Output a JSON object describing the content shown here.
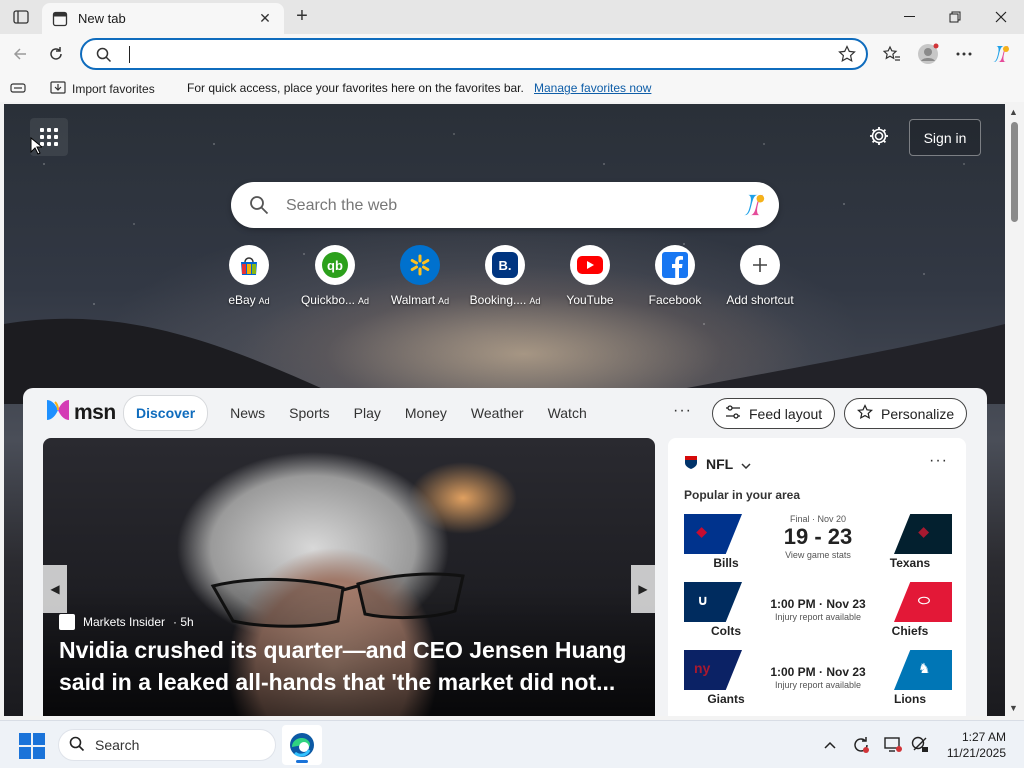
{
  "tab": {
    "title": "New tab"
  },
  "favbar": {
    "import_label": "Import favorites",
    "message": "For quick access, place your favorites here on the favorites bar.",
    "manage_link": "Manage favorites now"
  },
  "ntp": {
    "signin_label": "Sign in",
    "search_placeholder": "Search the web",
    "shortcuts": [
      {
        "label": "eBay",
        "ad": "Ad",
        "icon": "ebay-icon"
      },
      {
        "label": "Quickbo...",
        "ad": "Ad",
        "icon": "quickbooks-icon"
      },
      {
        "label": "Walmart",
        "ad": "Ad",
        "icon": "walmart-icon"
      },
      {
        "label": "Booking....",
        "ad": "Ad",
        "icon": "booking-icon"
      },
      {
        "label": "YouTube",
        "ad": "",
        "icon": "youtube-icon"
      },
      {
        "label": "Facebook",
        "ad": "",
        "icon": "facebook-icon"
      },
      {
        "label": "Add shortcut",
        "ad": "",
        "icon": "plus-icon"
      }
    ]
  },
  "feed": {
    "brand": "msn",
    "tabs": [
      "Discover",
      "News",
      "Sports",
      "Play",
      "Money",
      "Weather",
      "Watch"
    ],
    "more": "···",
    "feed_layout_label": "Feed layout",
    "personalize_label": "Personalize",
    "hero": {
      "source": "Markets Insider",
      "age": "· 5h",
      "headline": "Nvidia crushed its quarter—and CEO Jensen Huang said in a leaked all-hands that 'the market did not..."
    },
    "nfl": {
      "title": "NFL",
      "subtitle": "Popular in your area",
      "games": [
        {
          "left_team": "Bills",
          "right_team": "Texans",
          "status": "Final · Nov 20",
          "score": "19 - 23",
          "note": "View game stats",
          "left_color": "#00338d",
          "right_color": "#03202f"
        },
        {
          "left_team": "Colts",
          "right_team": "Chiefs",
          "time": "1:00 PM · Nov 23",
          "note": "Injury report available",
          "left_color": "#002c5f",
          "right_color": "#e31837"
        },
        {
          "left_team": "Giants",
          "right_team": "Lions",
          "time": "1:00 PM · Nov 23",
          "note": "Injury report available",
          "left_color": "#0b2265",
          "right_color": "#0076b6"
        }
      ]
    }
  },
  "taskbar": {
    "search_placeholder": "Search",
    "time": "1:27 AM",
    "date": "11/21/2025"
  },
  "colors": {
    "accent": "#0f6cbd",
    "link": "#0f5ea8"
  }
}
